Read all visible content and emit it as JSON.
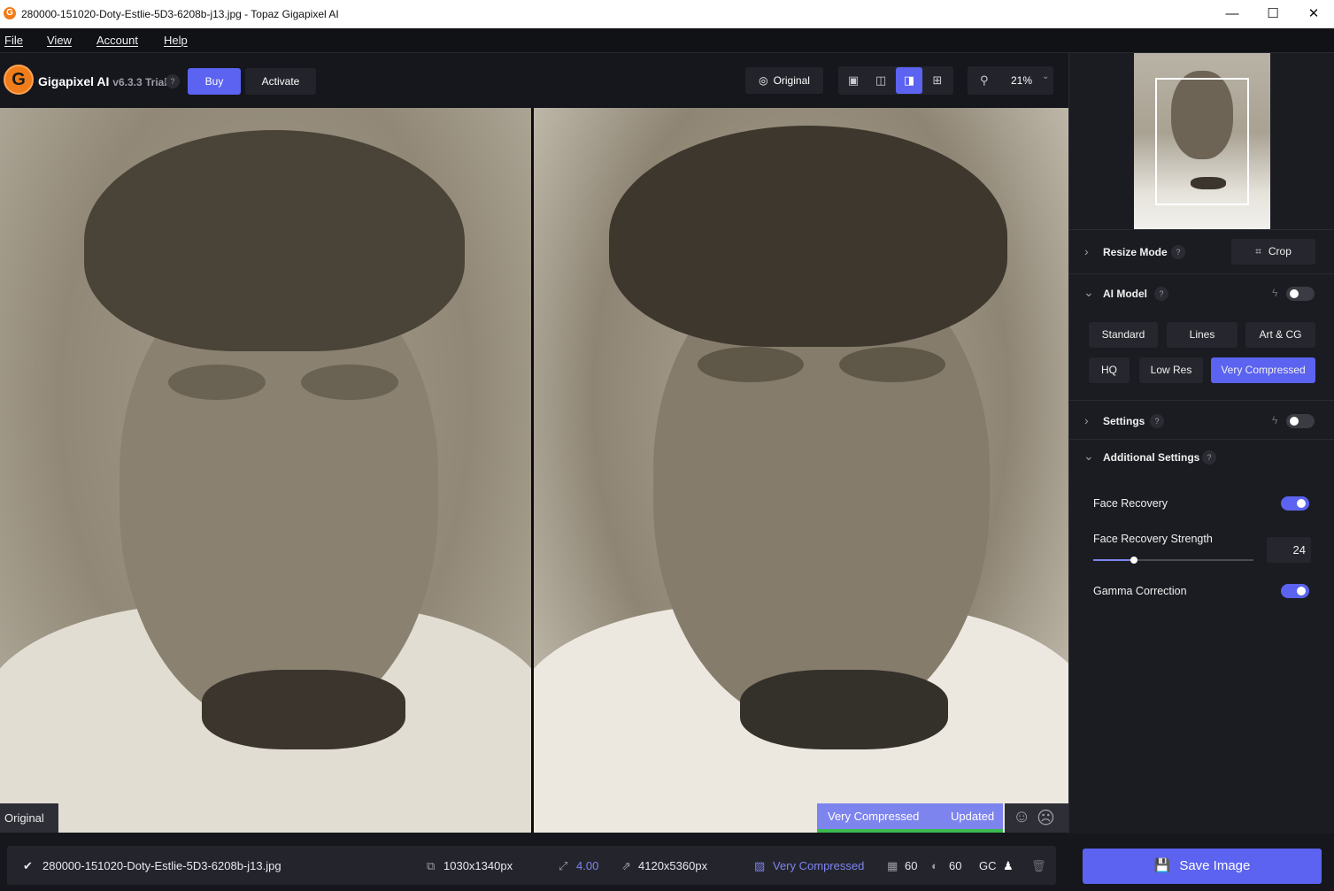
{
  "window": {
    "title": "280000-151020-Doty-Estlie-5D3-6208b-j13.jpg - Topaz Gigapixel AI",
    "minimize": "—",
    "maximize": "☐",
    "close": "✕"
  },
  "menu": [
    "File",
    "View",
    "Account",
    "Help"
  ],
  "toolbar": {
    "logo_letter": "G",
    "app_name": "Gigapixel AI",
    "version": "v6.3.3 Trial",
    "help": "?",
    "buy": "Buy",
    "activate": "Activate",
    "original": "Original",
    "zoom": "21%",
    "zoom_caret": "⌄"
  },
  "preview": {
    "original_label": "Original",
    "model_label": "Very Compressed",
    "status": "Updated"
  },
  "panel": {
    "resize_mode": "Resize Mode",
    "crop": "Crop",
    "ai_model": "AI Model",
    "models": [
      "Standard",
      "Lines",
      "Art & CG",
      "HQ",
      "Low Res",
      "Very Compressed"
    ],
    "active_model": "Very Compressed",
    "settings": "Settings",
    "additional_settings": "Additional Settings",
    "face_recovery": "Face Recovery",
    "face_recovery_on": true,
    "face_recovery_strength": "Face Recovery Strength",
    "face_recovery_strength_value": "24",
    "gamma_correction": "Gamma Correction",
    "gamma_correction_on": true,
    "help": "?"
  },
  "bottom": {
    "check": "✔",
    "filename": "280000-151020-Doty-Estlie-5D3-6208b-j13.jpg",
    "input_size": "1030x1340px",
    "scale": "4.00",
    "output_size": "4120x5360px",
    "model": "Very Compressed",
    "denoise": "60",
    "sharpen": "60",
    "gc": "GC",
    "save": "Save Image"
  },
  "colors": {
    "accent": "#5b63f0",
    "accent_light": "#7e84ee",
    "updated_bar": "#3bb94f",
    "logo": "#f07d1a"
  }
}
